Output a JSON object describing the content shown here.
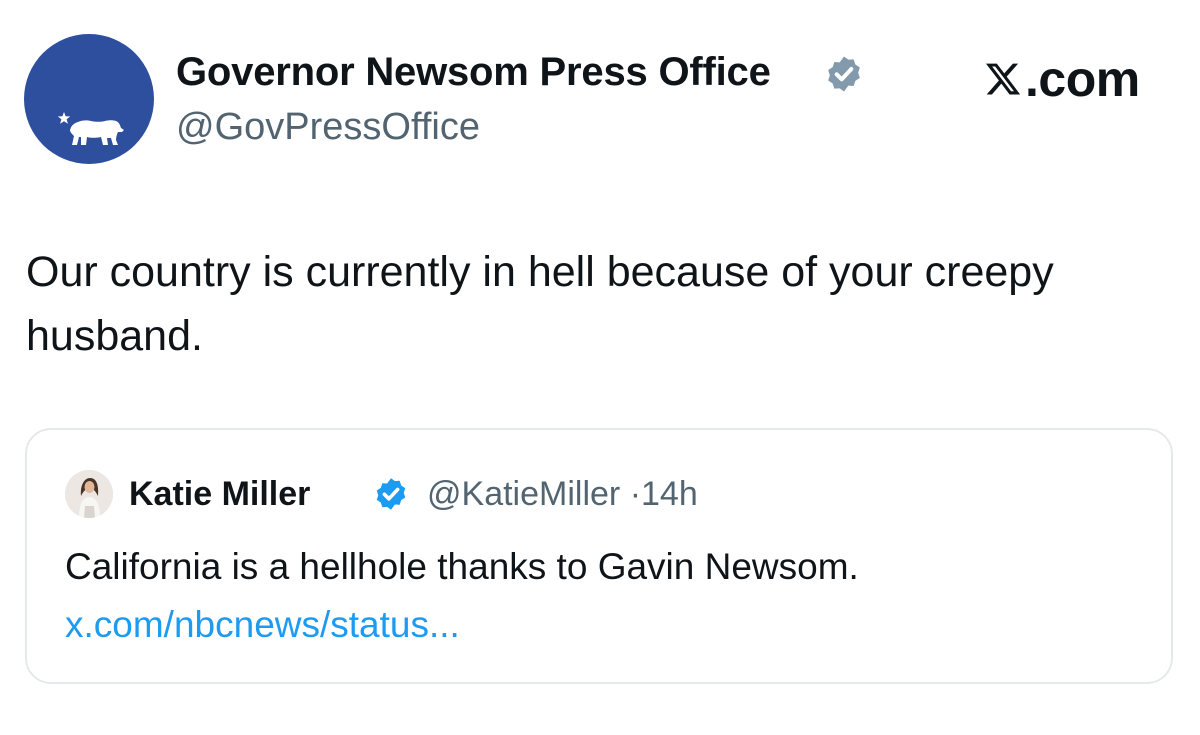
{
  "brand": {
    "site_label": ".com",
    "site_icon": "x-logo-icon"
  },
  "author": {
    "display_name": "Governor Newsom Press Office",
    "handle": "@GovPressOffice",
    "verified": "gray",
    "avatar_icon": "california-bear-star-icon",
    "avatar_color": "#2e4f9e"
  },
  "post": {
    "text": "Our country is currently in hell because of your creepy husband."
  },
  "quoted_post": {
    "display_name": "Katie Miller",
    "handle": "@KatieMiller",
    "separator": "·",
    "time": "14h",
    "verified": "blue",
    "text": "California is a hellhole thanks to Gavin Newsom.",
    "link_text": "x.com/nbcnews/status..."
  },
  "colors": {
    "text": "#0f1419",
    "secondary": "#536471",
    "link": "#1d9bf0",
    "verified_blue": "#1d9bf0",
    "verified_gray": "#829aab",
    "border": "#e6e9ec"
  }
}
